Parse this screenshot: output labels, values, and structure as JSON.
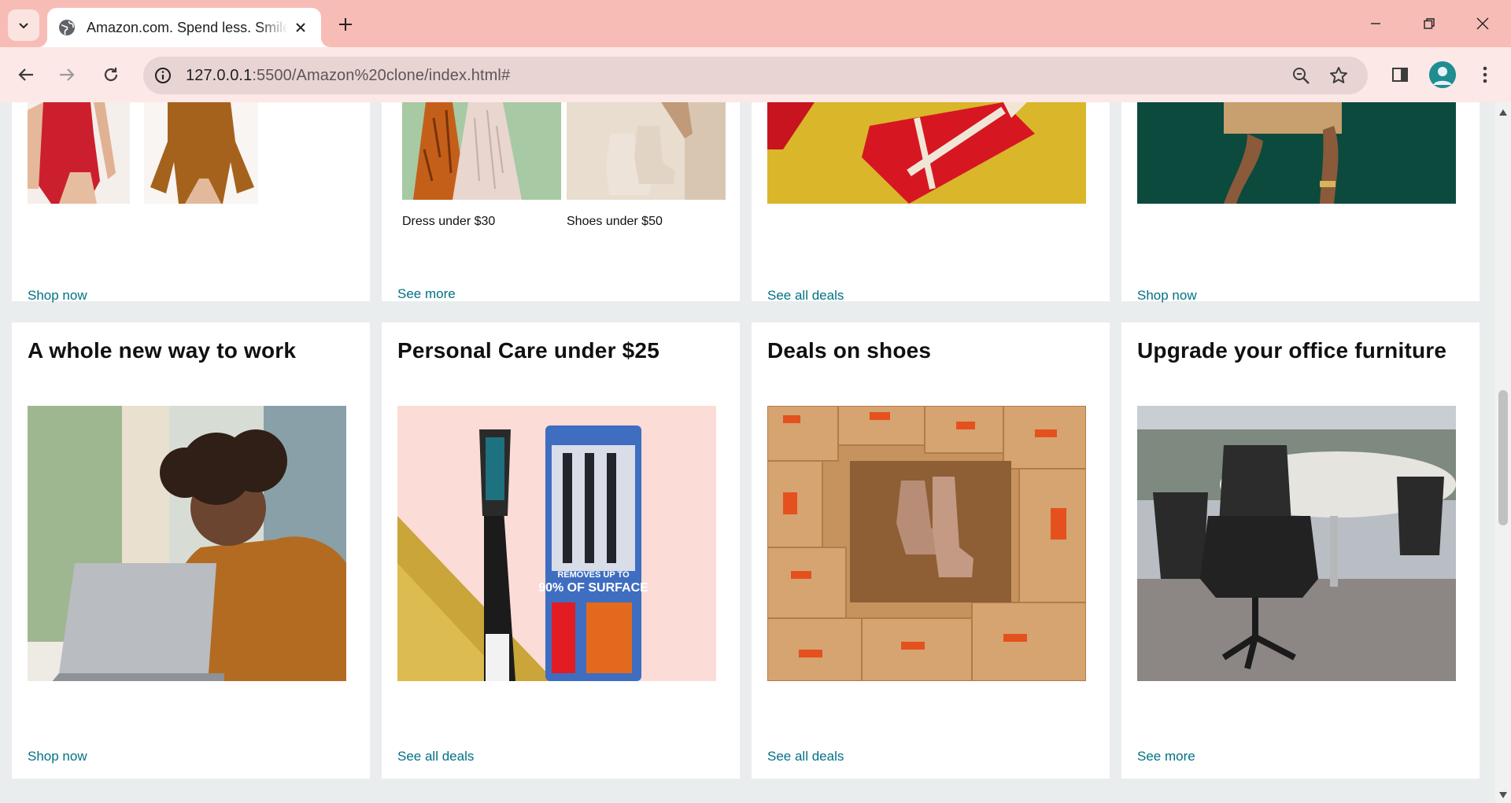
{
  "browser": {
    "tab_title": "Amazon.com. Spend less. Smile more.",
    "url_host": "127.0.0.1",
    "url_rest": ":5500/Amazon%20clone/index.html#"
  },
  "top_row": {
    "card1": {
      "link": "Shop now"
    },
    "card2": {
      "item1_label": "Dress under $30",
      "item2_label": "Shoes under $50",
      "link": "See more"
    },
    "card3": {
      "link": "See all deals"
    },
    "card4": {
      "link": "Shop now"
    }
  },
  "cards": [
    {
      "title": "A whole new way to work",
      "link": "Shop now",
      "image": "woman-laptop-image"
    },
    {
      "title": "Personal Care under $25",
      "link": "See all deals",
      "image": "toothbrush-image"
    },
    {
      "title": "Deals on shoes",
      "link": "See all deals",
      "image": "boots-in-boxes-image"
    },
    {
      "title": "Upgrade your office furniture",
      "link": "See more",
      "image": "office-chairs-image"
    }
  ],
  "colors": {
    "tab_strip": "#f8bcb6",
    "toolbar": "#fce8e6",
    "link": "#007185",
    "page_bg": "#eaeded"
  }
}
